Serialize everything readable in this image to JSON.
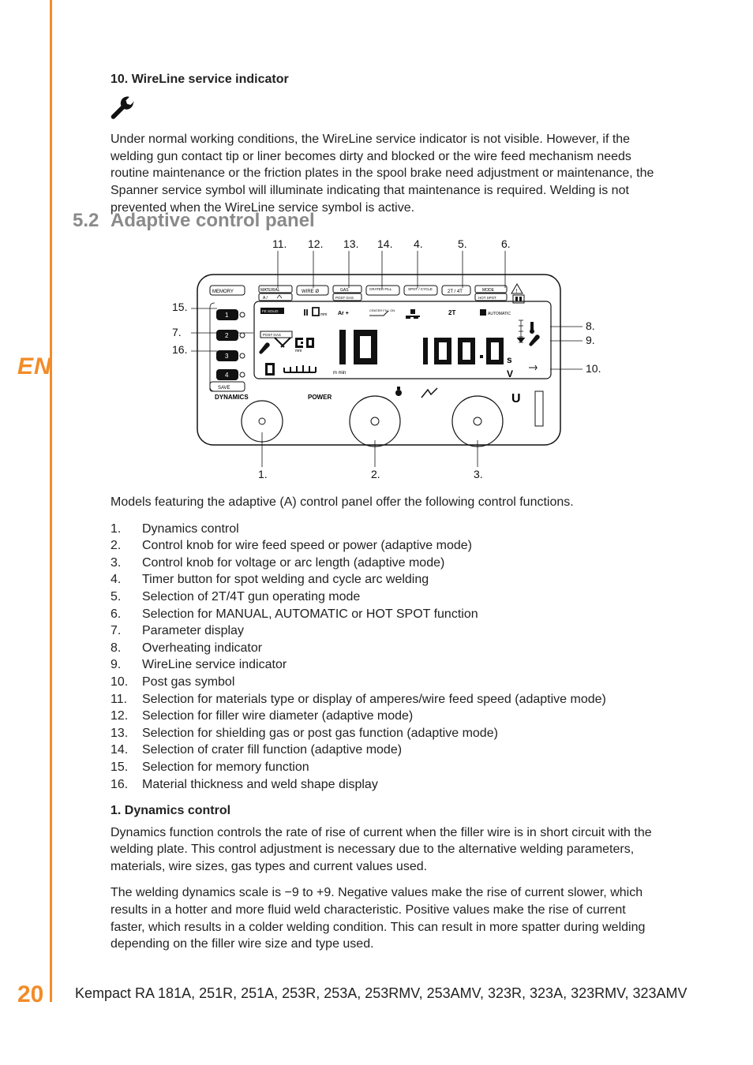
{
  "lang": "EN",
  "page_number": "20",
  "footer_models": "Kempact RA 181A, 251R, 251A, 253R, 253A, 253RMV, 253AMV, 323R, 323A, 323RMV, 323AMV",
  "item10": {
    "heading": "10. WireLine service indicator",
    "body": "Under normal working conditions, the WireLine service indicator is not visible. However, if the welding gun contact tip or liner becomes dirty and blocked or the wire feed mechanism needs routine maintenance or the friction plates in the spool brake need adjustment or maintenance, the Spanner service symbol will illuminate indicating that maintenance is required. Welding is not prevented when the WireLine service symbol is active."
  },
  "section": {
    "num": "5.2",
    "title": "Adaptive control panel"
  },
  "figure": {
    "top": {
      "11": "11.",
      "12": "12.",
      "13": "13.",
      "14": "14.",
      "4": "4.",
      "5": "5.",
      "6": "6."
    },
    "left": {
      "15": "15.",
      "7": "7.",
      "16": "16."
    },
    "right": {
      "8": "8.",
      "9": "9.",
      "10": "10."
    },
    "bottom": {
      "1": "1.",
      "2": "2.",
      "3": "3."
    },
    "panel": {
      "memory": "MEMORY",
      "save": "SAVE",
      "dynamics": "DYNAMICS",
      "power": "POWER",
      "material": "MATERIAL",
      "a_wfs": "A / ",
      "wire_o": "WIRE Ø",
      "gas": "GAS",
      "postgas": "POST GAS",
      "crater_fill": "CRATER FILL",
      "spot_cycle": "SPOT / CYCLE",
      "t2t4": "2T / 4T",
      "mode": "MODE",
      "hotspot": "HOT SPOT",
      "fesolid": "FE SOLID",
      "mm10": "mm",
      "arplus": "Ar +",
      "crater_on": "CRATER FILL ON",
      "automatic": "AUTOMATIC",
      "t2": "2T",
      "postgas2": "POST GAS",
      "thick_mm": "mm",
      "m_min": "m min",
      "s": "s",
      "V": "V",
      "U": "U",
      "d1": "1",
      "d2": "2",
      "d3": "3",
      "d4": "4"
    }
  },
  "intro": "Models featuring the adaptive (A) control panel offer the following control functions.",
  "list": [
    {
      "n": "1.",
      "t": "Dynamics control"
    },
    {
      "n": "2.",
      "t": "Control knob for wire feed speed or power (adaptive mode)"
    },
    {
      "n": "3.",
      "t": "Control knob for voltage or arc length (adaptive mode)"
    },
    {
      "n": "4.",
      "t": "Timer button for spot welding and cycle arc welding"
    },
    {
      "n": "5.",
      "t": "Selection of 2T/4T gun operating mode"
    },
    {
      "n": "6.",
      "t": "Selection for MANUAL, AUTOMATIC or HOT SPOT function"
    },
    {
      "n": "7.",
      "t": "Parameter display"
    },
    {
      "n": "8.",
      "t": "Overheating indicator"
    },
    {
      "n": "9.",
      "t": "WireLine service indicator"
    },
    {
      "n": "10.",
      "t": "Post gas symbol"
    },
    {
      "n": "11.",
      "t": "Selection for materials type or display of amperes/wire feed speed (adaptive mode)"
    },
    {
      "n": "12.",
      "t": "Selection for filler wire diameter (adaptive mode)"
    },
    {
      "n": "13.",
      "t": "Selection for shielding gas or post gas function (adaptive mode)"
    },
    {
      "n": "14.",
      "t": "Selection of crater fill function (adaptive mode)"
    },
    {
      "n": "15.",
      "t": "Selection for memory function"
    },
    {
      "n": "16.",
      "t": "Material thickness and weld shape display"
    }
  ],
  "dynamics": {
    "heading": "1. Dynamics control",
    "p1": "Dynamics function controls the rate of rise of current when the filler wire is in short circuit with the welding plate. This control adjustment is necessary due to the alternative welding parameters, materials, wire sizes, gas types and current values used.",
    "p2": "The welding dynamics scale is −9 to +9. Negative values make the rise of current slower, which results in a hotter and more fluid weld characteristic. Positive values make the rise of current faster, which results in a colder welding condition. This can result in more spatter during welding depending on the filler wire size and type used."
  }
}
